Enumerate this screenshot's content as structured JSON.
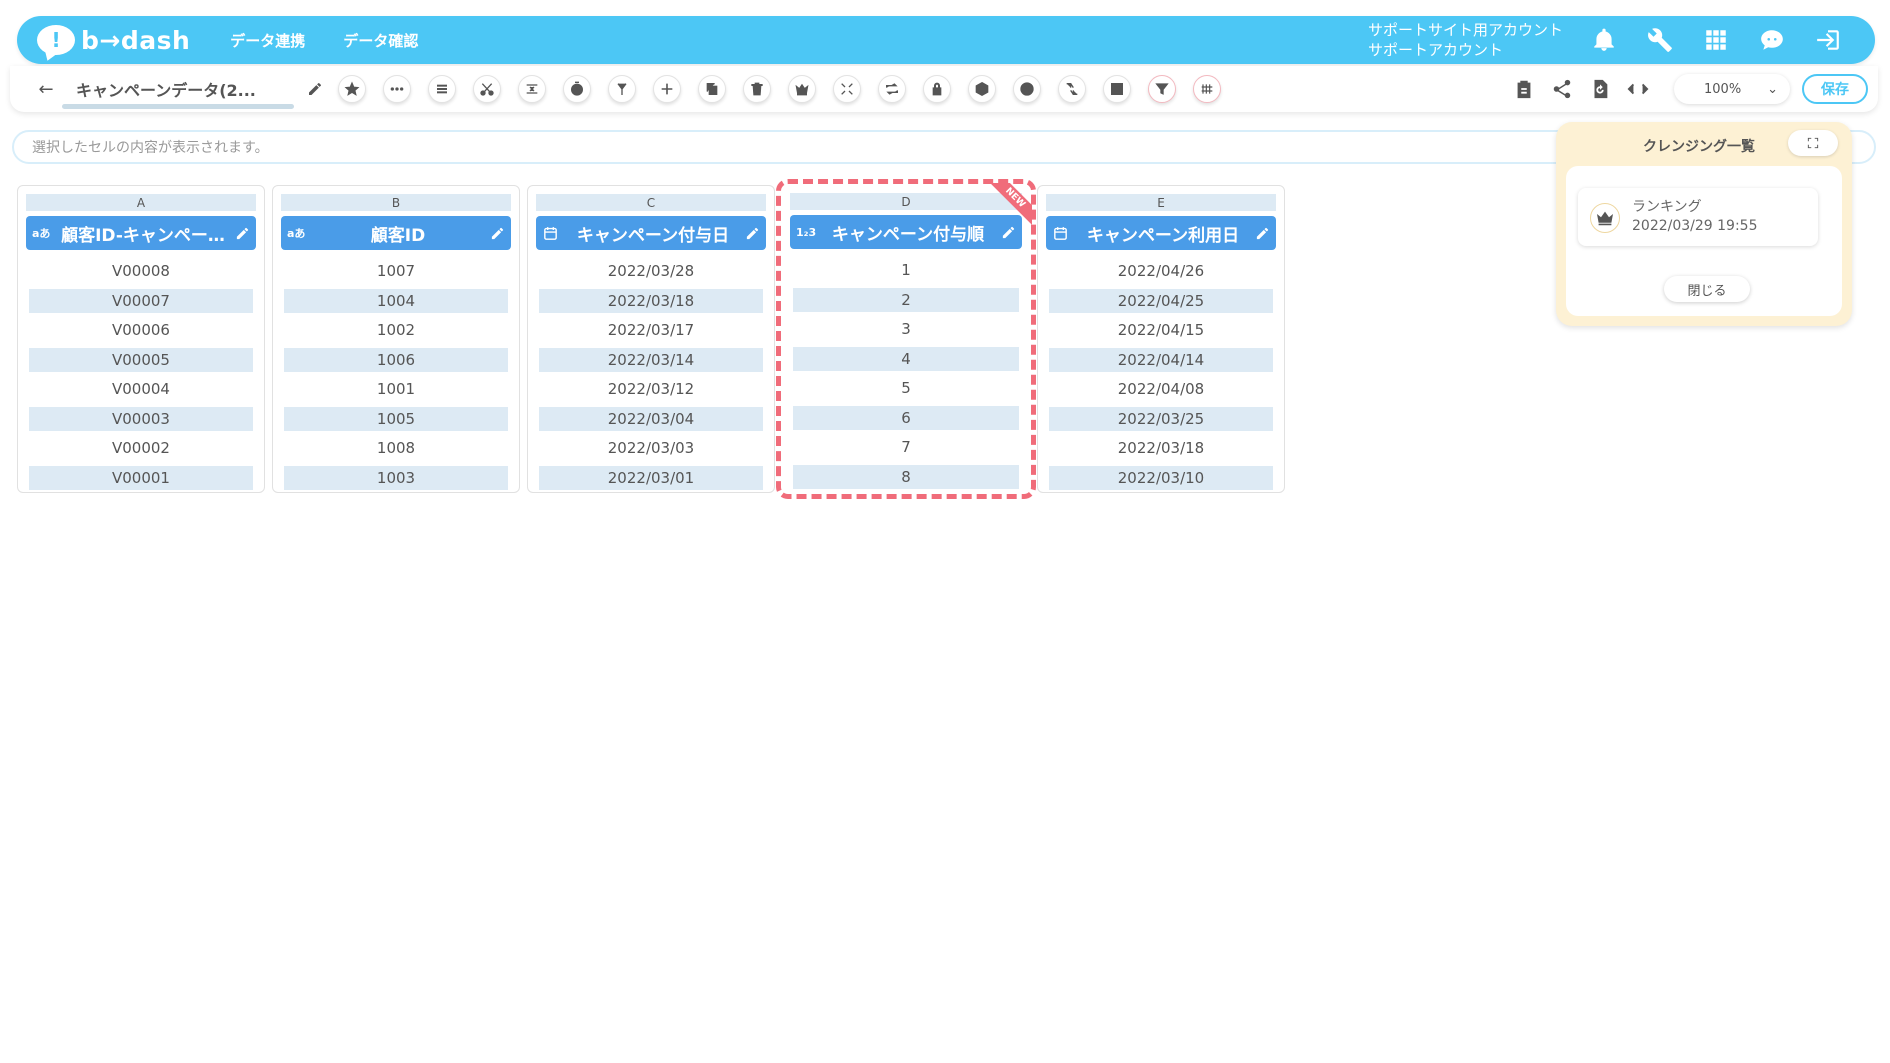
{
  "header": {
    "logo_text": "b→dash",
    "nav": [
      "データ連携",
      "データ確認"
    ],
    "account_line1": "サポートサイト用アカウント",
    "account_line2": "サポートアカウント"
  },
  "toolbar": {
    "title": "キャンペーンデータ(2...",
    "zoom": "100%",
    "save_label": "保存",
    "tools": [
      "star-icon",
      "dots-icon",
      "list-icon",
      "scissors-icon",
      "merge-icon",
      "timer-icon",
      "branch-icon",
      "plus-icon",
      "copy-icon",
      "trash-icon",
      "crown-icon",
      "compress-icon",
      "repeat-icon",
      "lock-icon",
      "box-icon",
      "cancel-icon",
      "convert-icon",
      "frame-icon",
      "filter-icon",
      "grid-icon"
    ]
  },
  "cell_bar": {
    "placeholder": "選択したセルの内容が表示されます。"
  },
  "columns": [
    {
      "letter": "A",
      "type": "aあ",
      "name": "顧客ID-キャンペー…",
      "cells": [
        "V00008",
        "V00007",
        "V00006",
        "V00005",
        "V00004",
        "V00003",
        "V00002",
        "V00001"
      ]
    },
    {
      "letter": "B",
      "type": "aあ",
      "name": "顧客ID",
      "cells": [
        "1007",
        "1004",
        "1002",
        "1006",
        "1001",
        "1005",
        "1008",
        "1003"
      ]
    },
    {
      "letter": "C",
      "type": "date",
      "name": "キャンペーン付与日",
      "cells": [
        "2022/03/28",
        "2022/03/18",
        "2022/03/17",
        "2022/03/14",
        "2022/03/12",
        "2022/03/04",
        "2022/03/03",
        "2022/03/01"
      ]
    },
    {
      "letter": "D",
      "type": "1₂3",
      "name": "キャンペーン付与順",
      "badge": "NEW",
      "cells": [
        "1",
        "2",
        "3",
        "4",
        "5",
        "6",
        "7",
        "8"
      ]
    },
    {
      "letter": "E",
      "type": "date",
      "name": "キャンペーン利用日",
      "cells": [
        "2022/04/26",
        "2022/04/25",
        "2022/04/15",
        "2022/04/14",
        "2022/04/08",
        "2022/03/25",
        "2022/03/18",
        "2022/03/10"
      ]
    }
  ],
  "cleansing": {
    "title": "クレンジング一覧",
    "item_name": "ランキング",
    "item_date": "2022/03/29 19:55",
    "close_label": "閉じる"
  },
  "colors": {
    "brand": "#4cc7f5",
    "column_header": "#4a9ce8",
    "highlight": "#f06c7a"
  }
}
